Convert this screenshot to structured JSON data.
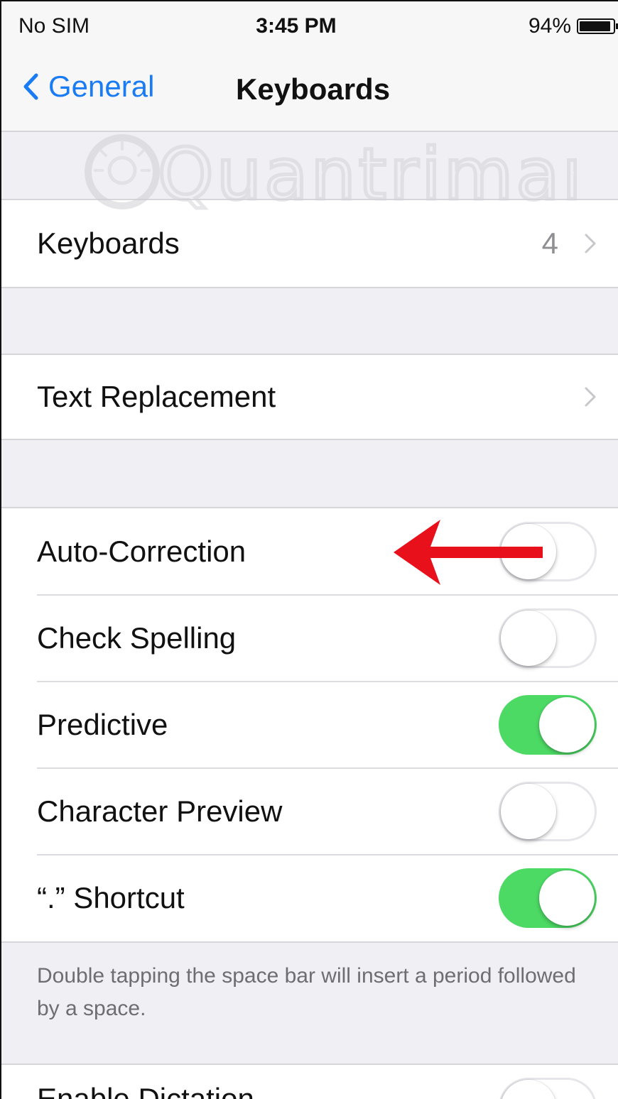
{
  "status_bar": {
    "carrier": "No SIM",
    "time": "3:45 PM",
    "battery_percent": "94%",
    "battery_level": 0.94
  },
  "nav": {
    "back_label": "General",
    "title": "Keyboards"
  },
  "watermark": {
    "text": "Quantrimang"
  },
  "groups": {
    "keyboards": {
      "label": "Keyboards",
      "value": "4"
    },
    "text_replacement": {
      "label": "Text Replacement"
    },
    "toggles": [
      {
        "label": "Auto-Correction",
        "on": false
      },
      {
        "label": "Check Spelling",
        "on": false
      },
      {
        "label": "Predictive",
        "on": true
      },
      {
        "label": "Character Preview",
        "on": false
      },
      {
        "label": "“.” Shortcut",
        "on": true
      }
    ],
    "shortcut_footer": "Double tapping the space bar will insert a period followed by a space.",
    "dictation": {
      "label": "Enable Dictation",
      "on": false
    }
  },
  "colors": {
    "accent": "#1a7cf5",
    "toggle_on": "#4cd964",
    "annotation_arrow": "#e8101a"
  }
}
